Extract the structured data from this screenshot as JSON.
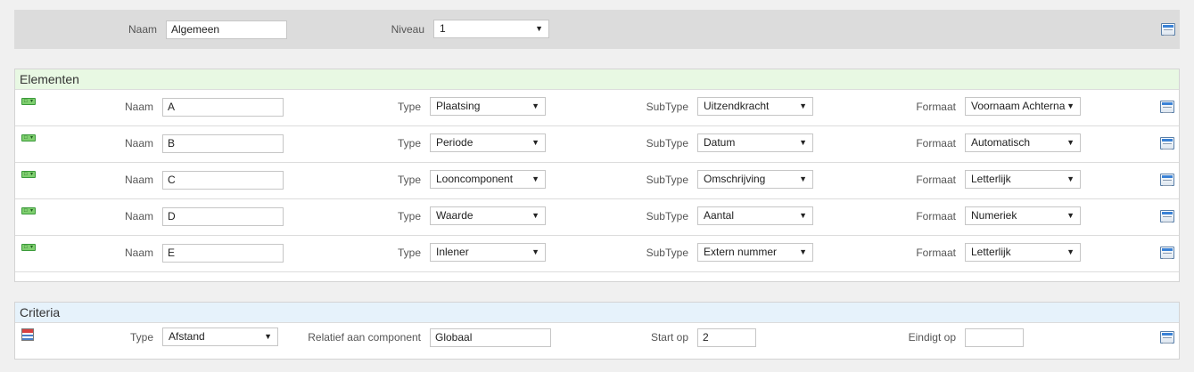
{
  "header": {
    "name_label": "Naam",
    "name_value": "Algemeen",
    "level_label": "Niveau",
    "level_value": "1",
    "menu_icon": "menu-icon"
  },
  "elements": {
    "title": "Elementen",
    "labels": {
      "name": "Naam",
      "type": "Type",
      "subtype": "SubType",
      "format": "Formaat"
    },
    "rows": [
      {
        "name": "A",
        "type": "Plaatsing",
        "subtype": "Uitzendkracht",
        "format": "Voornaam Achterna"
      },
      {
        "name": "B",
        "type": "Periode",
        "subtype": "Datum",
        "format": "Automatisch"
      },
      {
        "name": "C",
        "type": "Looncomponent",
        "subtype": "Omschrijving",
        "format": "Letterlijk"
      },
      {
        "name": "D",
        "type": "Waarde",
        "subtype": "Aantal",
        "format": "Numeriek"
      },
      {
        "name": "E",
        "type": "Inlener",
        "subtype": "Extern nummer",
        "format": "Letterlijk"
      }
    ]
  },
  "criteria": {
    "title": "Criteria",
    "type_label": "Type",
    "type_value": "Afstand",
    "relative_label": "Relatief aan component",
    "relative_value": "Globaal",
    "start_label": "Start op",
    "start_value": "2",
    "end_label": "Eindigt op",
    "end_value": ""
  }
}
